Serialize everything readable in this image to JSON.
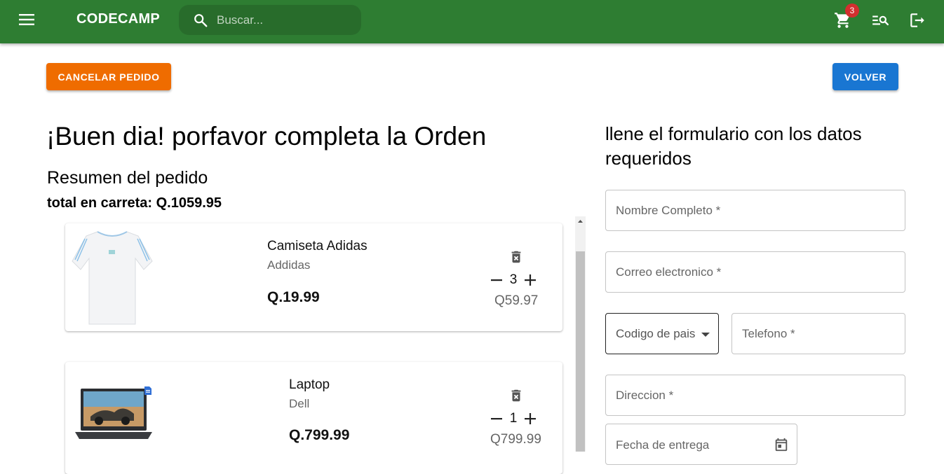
{
  "appbar": {
    "brand": "CODECAMP",
    "search_placeholder": "Buscar...",
    "cart_count": "3"
  },
  "actions": {
    "cancel_label": "CANCELAR PEDIDO",
    "back_label": "VOLVER"
  },
  "order": {
    "greeting": "¡Buen dia! porfavor completa la Orden",
    "summary_title": "Resumen del pedido",
    "total_text": "total en carreta: Q.1059.95",
    "items": [
      {
        "name": "Camiseta Adidas",
        "brand": "Addidas",
        "price": "Q.19.99",
        "qty": "3",
        "subtotal": "Q59.97"
      },
      {
        "name": "Laptop",
        "brand": "Dell",
        "price": "Q.799.99",
        "qty": "1",
        "subtotal": "Q799.99"
      }
    ]
  },
  "form": {
    "title": "llene el formulario con los datos requeridos",
    "fields": {
      "name": "Nombre Completo *",
      "email": "Correo electronico *",
      "country_code": "Codigo de pais",
      "phone": "Telefono *",
      "address": "Direccion *",
      "delivery_date": "Fecha de entrega"
    }
  },
  "colors": {
    "appbar": "#2e7d32",
    "cancel": "#ef6c00",
    "back": "#1976d2",
    "badge": "#d32f2f"
  }
}
